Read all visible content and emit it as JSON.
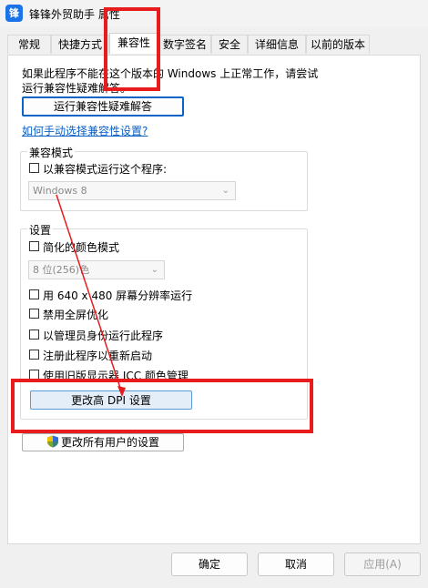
{
  "window": {
    "title": "锋锋外贸助手 属性",
    "icon_label": "锋"
  },
  "tabs": [
    {
      "label": "常规"
    },
    {
      "label": "快捷方式"
    },
    {
      "label": "兼容性"
    },
    {
      "label": "数字签名"
    },
    {
      "label": "安全"
    },
    {
      "label": "详细信息"
    },
    {
      "label": "以前的版本"
    }
  ],
  "compat": {
    "intro_line1": "如果此程序不能在这个版本的 Windows 上正常工作，请尝试",
    "intro_line2": "运行兼容性疑难解答。",
    "troubleshoot_button": "运行兼容性疑难解答",
    "manual_link": "如何手动选择兼容性设置?",
    "mode_group_label": "兼容模式",
    "mode_checkbox": "以兼容模式运行这个程序:",
    "mode_select": "Windows 8",
    "settings_group_label": "设置",
    "color_mode_checkbox": "简化的颜色模式",
    "color_select": "8 位(256)色",
    "res_checkbox": "用 640 x 480 屏幕分辨率运行",
    "fullscreen_checkbox": "禁用全屏优化",
    "admin_checkbox": "以管理员身份运行此程序",
    "restart_checkbox": "注册此程序以重新启动",
    "icc_checkbox": "使用旧版显示器 ICC 颜色管理",
    "dpi_button": "更改高 DPI 设置",
    "all_users_button": "更改所有用户的设置"
  },
  "footer": {
    "ok": "确定",
    "cancel": "取消",
    "apply": "应用(A)"
  },
  "colors": {
    "annotation": "#e81c1c",
    "link": "#0b5fc6",
    "focus": "#0a64c8"
  }
}
